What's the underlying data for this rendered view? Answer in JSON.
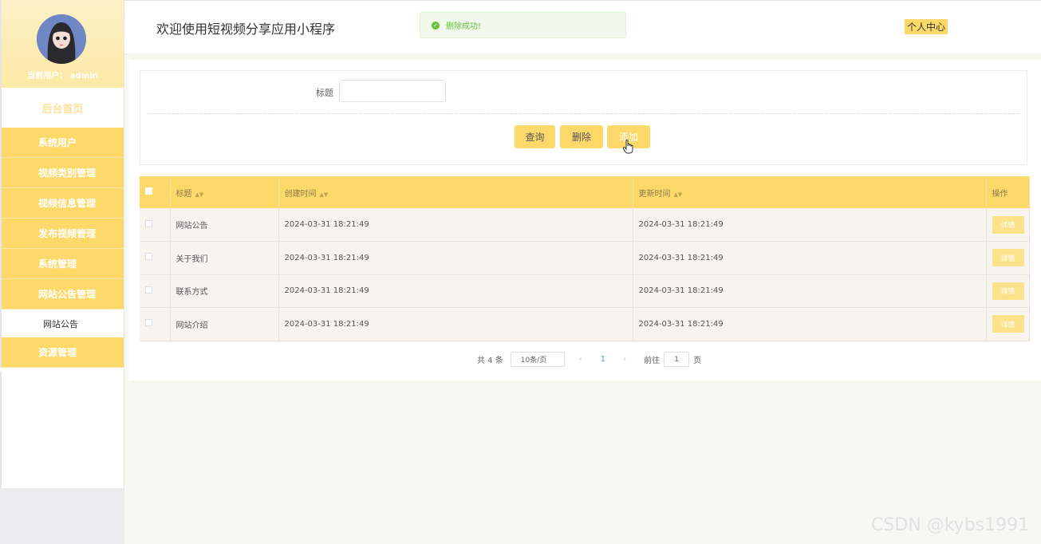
{
  "header": {
    "app_title": "欢迎使用短视频分享应用小程序",
    "personal_center": "个人中心",
    "toast_message": "删除成功!"
  },
  "sidebar": {
    "current_user_label": "当前用户： admin",
    "home": "后台首页",
    "items": [
      {
        "label": "系统用户"
      },
      {
        "label": "视频类别管理"
      },
      {
        "label": "视频信息管理"
      },
      {
        "label": "发布视频管理"
      },
      {
        "label": "系统管理"
      },
      {
        "label": "网站公告管理"
      }
    ],
    "subitem": "网站公告",
    "last_item": "资源管理"
  },
  "search": {
    "label": "标题",
    "value": "",
    "buttons": {
      "query": "查询",
      "delete": "删除",
      "add": "添加"
    }
  },
  "table": {
    "columns": [
      "标题",
      "创建时间",
      "更新时间",
      "操作"
    ],
    "rows": [
      {
        "title": "网站公告",
        "created": "2024-03-31 18:21:49",
        "updated": "2024-03-31 18:21:49",
        "action": "详情"
      },
      {
        "title": "关于我们",
        "created": "2024-03-31 18:21:49",
        "updated": "2024-03-31 18:21:49",
        "action": "详情"
      },
      {
        "title": "联系方式",
        "created": "2024-03-31 18:21:49",
        "updated": "2024-03-31 18:21:49",
        "action": "详情"
      },
      {
        "title": "网站介绍",
        "created": "2024-03-31 18:21:49",
        "updated": "2024-03-31 18:21:49",
        "action": "详情"
      }
    ]
  },
  "pagination": {
    "total": "共 4 条",
    "page_size": "10条/页",
    "prev": "‹",
    "current_page": "1",
    "next": "›",
    "goto_label": "前往",
    "goto_value": "1",
    "page_suffix": "页"
  },
  "watermark": "CSDN @kybs1991",
  "colors": {
    "accent": "#fdd96a",
    "success": "#67c23a",
    "link": "#409eff"
  }
}
